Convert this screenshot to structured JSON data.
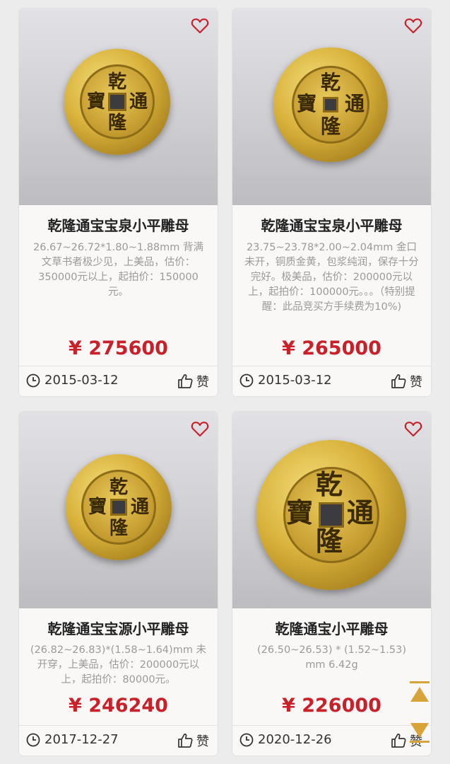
{
  "colors": {
    "accent": "#c8212a",
    "heart": "#c8212a",
    "scroll": "#d8a43a"
  },
  "icons": {
    "favorite": "heart-outline-icon",
    "date": "clock-icon",
    "like": "thumbs-up-icon",
    "scroll_top": "scroll-to-top-icon",
    "scroll_bottom": "scroll-to-bottom-icon"
  },
  "coin_chars": {
    "top": "乾",
    "bottom": "隆",
    "right": "通",
    "left": "寶"
  },
  "items": [
    {
      "title": "乾隆通宝宝泉小平雕母",
      "desc": "26.67~26.72*1.80~1.88mm 背满文草书者极少见，上美品，估价：350000元以上，起拍价：150000元。",
      "price": "¥ 275600",
      "date": "2015-03-12",
      "like": "赞"
    },
    {
      "title": "乾隆通宝宝泉小平雕母",
      "desc": "23.75~23.78*2.00~2.04mm 金口未开，铜质金黄，包浆纯润，保存十分完好。极美品，估价：200000元以上，起拍价：100000元。。。（特别提醒：此品竞买方手续费为10%)",
      "price": "¥ 265000",
      "date": "2015-03-12",
      "like": "赞"
    },
    {
      "title": "乾隆通宝宝源小平雕母",
      "desc": "(26.82~26.83)*(1.58~1.64)mm 未开穿，上美品，估价：200000元以上，起拍价：80000元。",
      "price": "¥ 246240",
      "date": "2017-12-27",
      "like": "赞"
    },
    {
      "title": "乾隆通宝小平雕母",
      "desc": "(26.50~26.53) * (1.52~1.53) mm 6.42g",
      "price": "¥ 226000",
      "date": "2020-12-26",
      "like": "赞"
    }
  ]
}
